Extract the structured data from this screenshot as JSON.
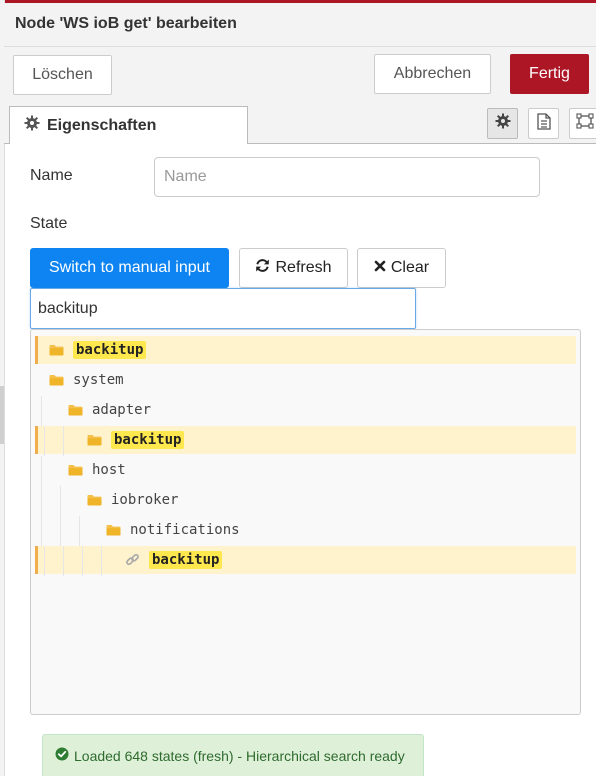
{
  "header": {
    "title": "Node 'WS ioB get' bearbeiten"
  },
  "toolbar": {
    "delete_label": "Löschen",
    "cancel_label": "Abbrechen",
    "done_label": "Fertig"
  },
  "tabs": {
    "properties_label": "Eigenschaften"
  },
  "form": {
    "name_label": "Name",
    "name_placeholder": "Name",
    "name_value": "",
    "state_label": "State",
    "manual_button": "Switch to manual input",
    "refresh_button": "Refresh",
    "clear_button": "Clear",
    "search_value": "backitup"
  },
  "tree": {
    "items": [
      {
        "label": "backitup",
        "depth": 0,
        "icon": "folder-icon",
        "highlighted": true
      },
      {
        "label": "system",
        "depth": 0,
        "icon": "folder-icon",
        "highlighted": false
      },
      {
        "label": "adapter",
        "depth": 1,
        "icon": "folder-icon",
        "highlighted": false
      },
      {
        "label": "backitup",
        "depth": 2,
        "icon": "folder-icon",
        "highlighted": true
      },
      {
        "label": "host",
        "depth": 1,
        "icon": "folder-icon",
        "highlighted": false
      },
      {
        "label": "iobroker",
        "depth": 2,
        "icon": "folder-icon",
        "highlighted": false
      },
      {
        "label": "notifications",
        "depth": 3,
        "icon": "folder-icon",
        "highlighted": false
      },
      {
        "label": "backitup",
        "depth": 4,
        "icon": "link-icon",
        "highlighted": true
      }
    ]
  },
  "status": {
    "text": "Loaded 648 states (fresh) - Hierarchical search ready",
    "icon": "check-circle-icon"
  },
  "colors": {
    "accent": "#ad1625",
    "primary": "#0d84f1",
    "highlight": "#ffe84d",
    "highlight_row": "#fff3cd",
    "success_bg": "#dff0d8"
  }
}
